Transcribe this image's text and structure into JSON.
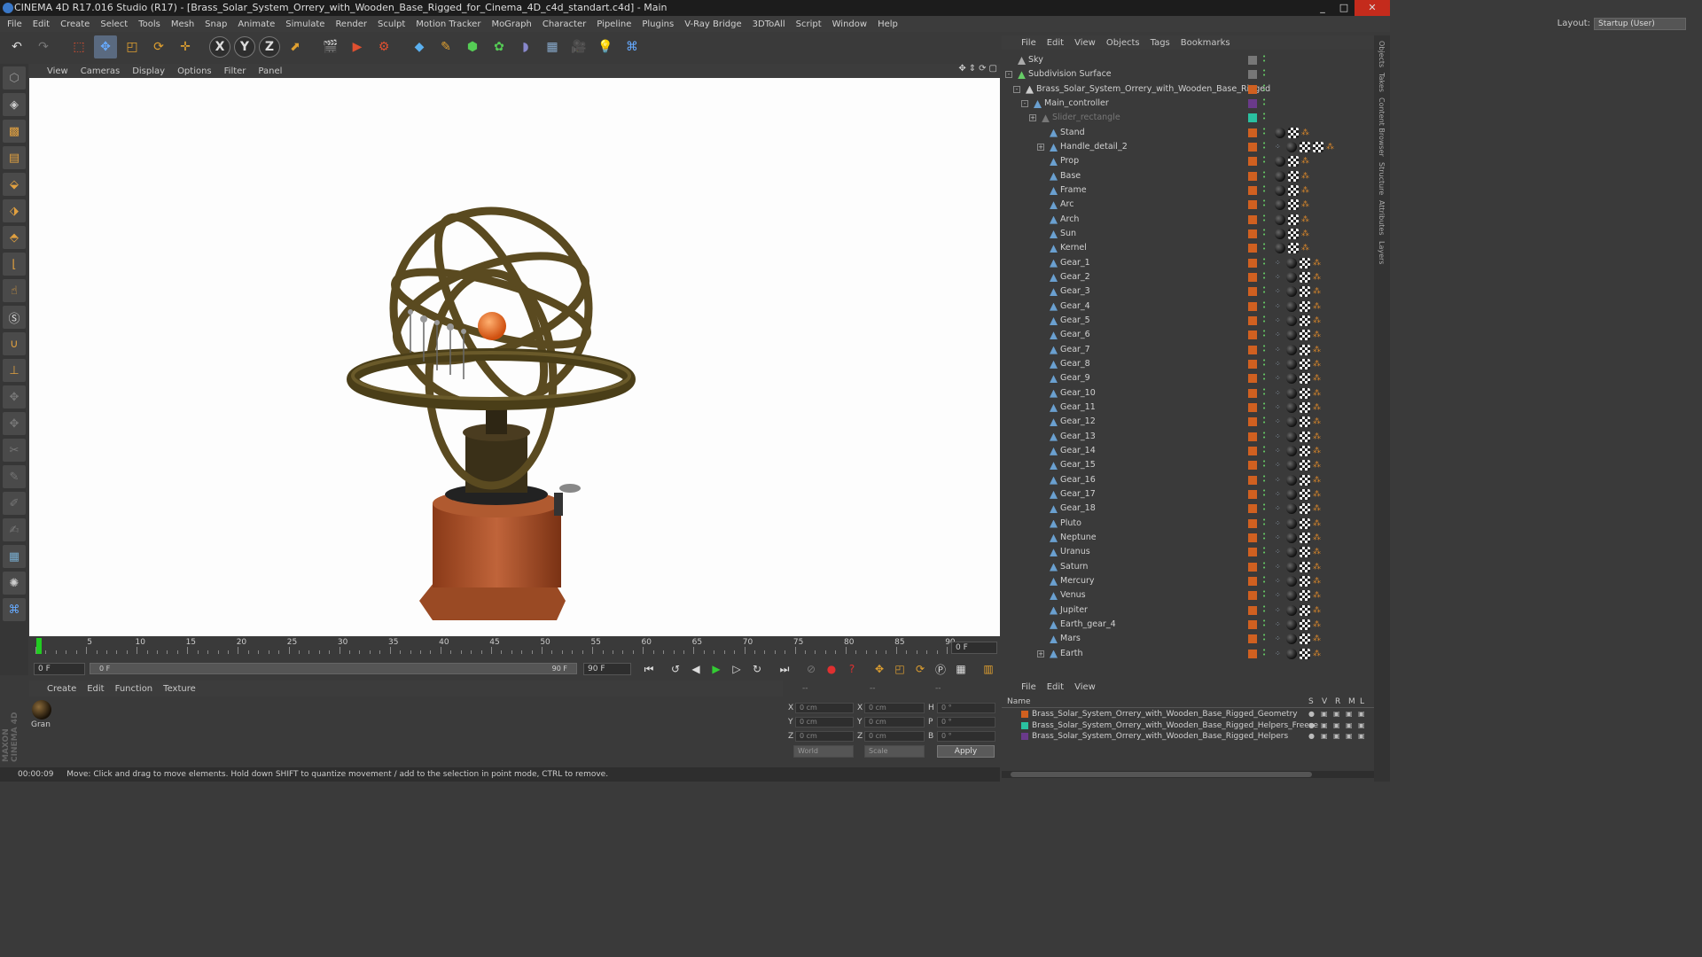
{
  "window": {
    "title": "CINEMA 4D R17.016 Studio (R17) - [Brass_Solar_System_Orrery_with_Wooden_Base_Rigged_for_Cinema_4D_c4d_standart.c4d] - Main",
    "min": "_",
    "max": "□",
    "close": "✕"
  },
  "menu": [
    "File",
    "Edit",
    "Create",
    "Select",
    "Tools",
    "Mesh",
    "Snap",
    "Animate",
    "Simulate",
    "Render",
    "Sculpt",
    "Motion Tracker",
    "MoGraph",
    "Character",
    "Pipeline",
    "Plugins",
    "V-Ray Bridge",
    "3DToAll",
    "Script",
    "Window",
    "Help"
  ],
  "layout": {
    "label": "Layout:",
    "value": "Startup (User)"
  },
  "viewport_menu": [
    "View",
    "Cameras",
    "Display",
    "Options",
    "Filter",
    "Panel"
  ],
  "timeline": {
    "ticks": [
      "0",
      "5",
      "10",
      "15",
      "20",
      "25",
      "30",
      "35",
      "40",
      "45",
      "50",
      "55",
      "60",
      "65",
      "70",
      "75",
      "80",
      "85",
      "90"
    ],
    "current_frame": "0 F",
    "start_frame": "0 F",
    "slider_start": "0 F",
    "slider_end": "90 F",
    "end_frame": "90 F"
  },
  "material_panel": {
    "menu": [
      "Create",
      "Edit",
      "Function",
      "Texture"
    ],
    "material_name": "Gran"
  },
  "coords": {
    "dash1": "--",
    "dash2": "--",
    "dash3": "--",
    "rows": [
      {
        "a": "X",
        "av": "0 cm",
        "b": "X",
        "bv": "0 cm",
        "c": "H",
        "cv": "0 °"
      },
      {
        "a": "Y",
        "av": "0 cm",
        "b": "Y",
        "bv": "0 cm",
        "c": "P",
        "cv": "0 °"
      },
      {
        "a": "Z",
        "av": "0 cm",
        "b": "Z",
        "bv": "0 cm",
        "c": "B",
        "cv": "0 °"
      }
    ],
    "space": "World",
    "mode": "Scale",
    "apply": "Apply"
  },
  "status": {
    "time": "00:00:09",
    "message": "Move: Click and drag to move elements. Hold down SHIFT to quantize movement / add to the selection in point mode, CTRL to remove."
  },
  "object_manager": {
    "menu": [
      "File",
      "Edit",
      "View",
      "Objects",
      "Tags",
      "Bookmarks"
    ],
    "objects": [
      {
        "name": "Sky",
        "indent": 0,
        "color": "#777777",
        "icon": "#aaaaaa"
      },
      {
        "name": "Subdivision Surface",
        "indent": 0,
        "color": "#777777",
        "icon": "#66cc66"
      },
      {
        "name": "Brass_Solar_System_Orrery_with_Wooden_Base_Rigged",
        "indent": 1,
        "color": "#d06020",
        "icon": "#cccccc"
      },
      {
        "name": "Main_controller",
        "indent": 2,
        "color": "#6a3a8a",
        "icon": "#6aa0d0"
      },
      {
        "name": "Slider_rectangle",
        "indent": 3,
        "color": "#2ac0a0",
        "icon": "#777777"
      },
      {
        "name": "Stand",
        "indent": 4,
        "color": "#d06020",
        "icon": "#6aa0d0"
      },
      {
        "name": "Handle_detail_2",
        "indent": 4,
        "color": "#d06020",
        "icon": "#6aa0d0"
      },
      {
        "name": "Prop",
        "indent": 4,
        "color": "#d06020",
        "icon": "#6aa0d0"
      },
      {
        "name": "Base",
        "indent": 4,
        "color": "#d06020",
        "icon": "#6aa0d0"
      },
      {
        "name": "Frame",
        "indent": 4,
        "color": "#d06020",
        "icon": "#6aa0d0"
      },
      {
        "name": "Arc",
        "indent": 4,
        "color": "#d06020",
        "icon": "#6aa0d0"
      },
      {
        "name": "Arch",
        "indent": 4,
        "color": "#d06020",
        "icon": "#6aa0d0"
      },
      {
        "name": "Sun",
        "indent": 4,
        "color": "#d06020",
        "icon": "#6aa0d0"
      },
      {
        "name": "Kernel",
        "indent": 4,
        "color": "#d06020",
        "icon": "#6aa0d0"
      },
      {
        "name": "Gear_1",
        "indent": 4,
        "color": "#d06020",
        "icon": "#6aa0d0"
      },
      {
        "name": "Gear_2",
        "indent": 4,
        "color": "#d06020",
        "icon": "#6aa0d0"
      },
      {
        "name": "Gear_3",
        "indent": 4,
        "color": "#d06020",
        "icon": "#6aa0d0"
      },
      {
        "name": "Gear_4",
        "indent": 4,
        "color": "#d06020",
        "icon": "#6aa0d0"
      },
      {
        "name": "Gear_5",
        "indent": 4,
        "color": "#d06020",
        "icon": "#6aa0d0"
      },
      {
        "name": "Gear_6",
        "indent": 4,
        "color": "#d06020",
        "icon": "#6aa0d0"
      },
      {
        "name": "Gear_7",
        "indent": 4,
        "color": "#d06020",
        "icon": "#6aa0d0"
      },
      {
        "name": "Gear_8",
        "indent": 4,
        "color": "#d06020",
        "icon": "#6aa0d0"
      },
      {
        "name": "Gear_9",
        "indent": 4,
        "color": "#d06020",
        "icon": "#6aa0d0"
      },
      {
        "name": "Gear_10",
        "indent": 4,
        "color": "#d06020",
        "icon": "#6aa0d0"
      },
      {
        "name": "Gear_11",
        "indent": 4,
        "color": "#d06020",
        "icon": "#6aa0d0"
      },
      {
        "name": "Gear_12",
        "indent": 4,
        "color": "#d06020",
        "icon": "#6aa0d0"
      },
      {
        "name": "Gear_13",
        "indent": 4,
        "color": "#d06020",
        "icon": "#6aa0d0"
      },
      {
        "name": "Gear_14",
        "indent": 4,
        "color": "#d06020",
        "icon": "#6aa0d0"
      },
      {
        "name": "Gear_15",
        "indent": 4,
        "color": "#d06020",
        "icon": "#6aa0d0"
      },
      {
        "name": "Gear_16",
        "indent": 4,
        "color": "#d06020",
        "icon": "#6aa0d0"
      },
      {
        "name": "Gear_17",
        "indent": 4,
        "color": "#d06020",
        "icon": "#6aa0d0"
      },
      {
        "name": "Gear_18",
        "indent": 4,
        "color": "#d06020",
        "icon": "#6aa0d0"
      },
      {
        "name": "Pluto",
        "indent": 4,
        "color": "#d06020",
        "icon": "#6aa0d0"
      },
      {
        "name": "Neptune",
        "indent": 4,
        "color": "#d06020",
        "icon": "#6aa0d0"
      },
      {
        "name": "Uranus",
        "indent": 4,
        "color": "#d06020",
        "icon": "#6aa0d0"
      },
      {
        "name": "Saturn",
        "indent": 4,
        "color": "#d06020",
        "icon": "#6aa0d0"
      },
      {
        "name": "Mercury",
        "indent": 4,
        "color": "#d06020",
        "icon": "#6aa0d0"
      },
      {
        "name": "Venus",
        "indent": 4,
        "color": "#d06020",
        "icon": "#6aa0d0"
      },
      {
        "name": "Jupiter",
        "indent": 4,
        "color": "#d06020",
        "icon": "#6aa0d0"
      },
      {
        "name": "Earth_gear_4",
        "indent": 4,
        "color": "#d06020",
        "icon": "#6aa0d0"
      },
      {
        "name": "Mars",
        "indent": 4,
        "color": "#d06020",
        "icon": "#6aa0d0"
      },
      {
        "name": "Earth",
        "indent": 4,
        "color": "#d06020",
        "icon": "#6aa0d0"
      }
    ]
  },
  "layer_manager": {
    "menu": [
      "File",
      "Edit",
      "View"
    ],
    "header": {
      "name": "Name",
      "s": "S",
      "v": "V",
      "r": "R",
      "m": "M",
      "l": "L"
    },
    "layers": [
      {
        "name": "Brass_Solar_System_Orrery_with_Wooden_Base_Rigged_Geometry",
        "color": "#d06020"
      },
      {
        "name": "Brass_Solar_System_Orrery_with_Wooden_Base_Rigged_Helpers_Freeze",
        "color": "#2ac0a0"
      },
      {
        "name": "Brass_Solar_System_Orrery_with_Wooden_Base_Rigged_Helpers",
        "color": "#6a3a8a"
      }
    ]
  },
  "side_tabs": [
    "Objects",
    "Takes",
    "Content Browser",
    "Structure",
    "Attributes",
    "Layers"
  ],
  "brand": "MAXON CINEMA 4D"
}
